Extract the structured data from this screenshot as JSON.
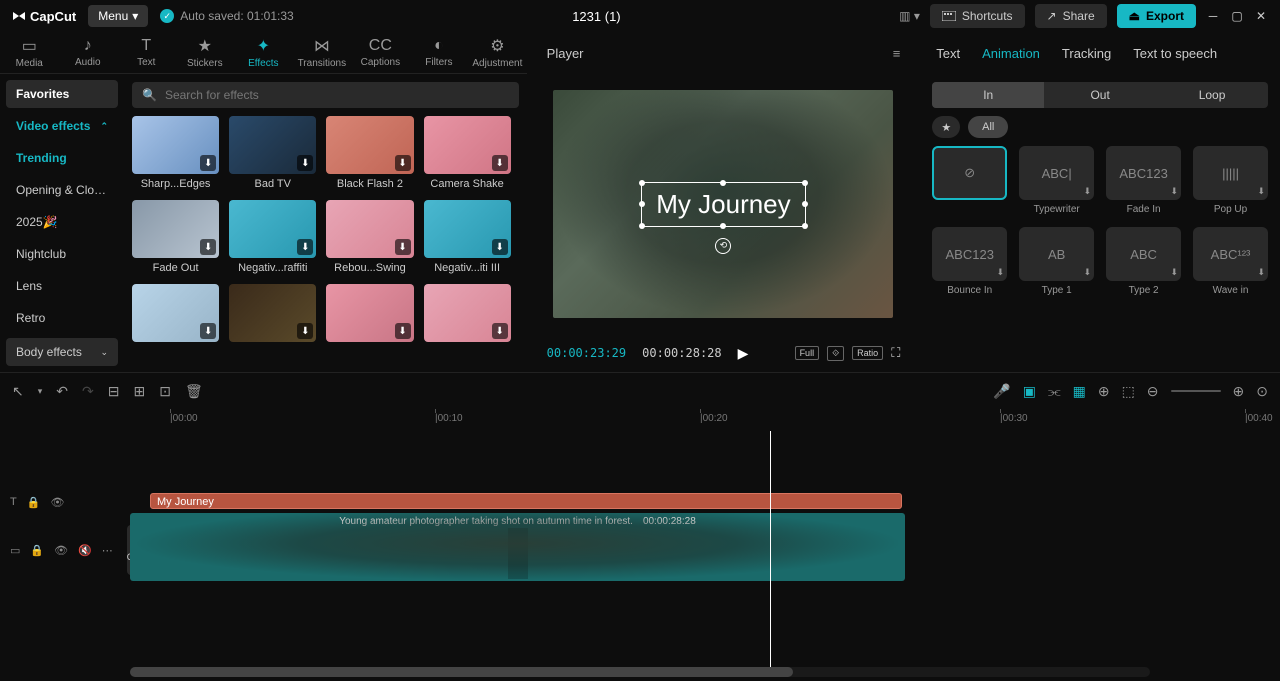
{
  "titlebar": {
    "app": "CapCut",
    "menu": "Menu",
    "autosaved": "Auto saved: 01:01:33",
    "project": "1231 (1)",
    "shortcuts": "Shortcuts",
    "share": "Share",
    "export": "Export"
  },
  "tabs": [
    "Media",
    "Audio",
    "Text",
    "Stickers",
    "Effects",
    "Transitions",
    "Captions",
    "Filters",
    "Adjustment"
  ],
  "activeTab": 4,
  "sidebar": {
    "items": [
      "Favorites",
      "Video effects",
      "Trending",
      "Opening & Clos...",
      "2025🎉",
      "Nightclub",
      "Lens",
      "Retro"
    ],
    "bottom": "Body effects"
  },
  "search": {
    "placeholder": "Search for effects"
  },
  "effects": [
    {
      "label": "Sharp...Edges",
      "bg": "linear-gradient(135deg,#a8c4e8,#6890c0)"
    },
    {
      "label": "Bad TV",
      "bg": "linear-gradient(135deg,#2a4a6a,#1a2a3a)"
    },
    {
      "label": "Black Flash 2",
      "bg": "linear-gradient(135deg,#d88575,#c06555)"
    },
    {
      "label": "Camera Shake",
      "bg": "linear-gradient(135deg,#e895a5,#d07585)"
    },
    {
      "label": "Fade Out",
      "bg": "linear-gradient(135deg,#8898a8,#b8c4d0)"
    },
    {
      "label": "Negativ...raffiti",
      "bg": "linear-gradient(135deg,#4ab8d0,#2898b0)"
    },
    {
      "label": "Rebou...Swing",
      "bg": "linear-gradient(135deg,#e8a5b5,#d88595)"
    },
    {
      "label": "Negativ...iti III",
      "bg": "linear-gradient(135deg,#4ab8d0,#2898b0)"
    },
    {
      "label": "",
      "bg": "linear-gradient(135deg,#b8d4e8,#98b4c8)"
    },
    {
      "label": "",
      "bg": "linear-gradient(135deg,#3a2a1a,#5a4a2a)"
    },
    {
      "label": "",
      "bg": "linear-gradient(135deg,#e895a5,#c87585)"
    },
    {
      "label": "",
      "bg": "linear-gradient(135deg,#e8a5b5,#d88595)"
    }
  ],
  "player": {
    "label": "Player",
    "text": "My Journey",
    "tc1": "00:00:23:29",
    "tc2": "00:00:28:28",
    "full": "Full",
    "ratio": "Ratio"
  },
  "inspector": {
    "tabs": [
      "Text",
      "Animation",
      "Tracking",
      "Text to speech"
    ],
    "activeTab": 1,
    "seg": [
      "In",
      "Out",
      "Loop"
    ],
    "activeSeg": 0,
    "all": "All",
    "items": [
      {
        "label": "",
        "sel": true,
        "t": "⊘"
      },
      {
        "label": "Typewriter",
        "t": "ABC|"
      },
      {
        "label": "Fade In",
        "t": "ABC123"
      },
      {
        "label": "Pop Up",
        "t": "|||||"
      },
      {
        "label": "Bounce In",
        "t": "ABC123"
      },
      {
        "label": "Type 1",
        "t": "AB"
      },
      {
        "label": "Type 2",
        "t": "ABC"
      },
      {
        "label": "Wave in",
        "t": "ABC¹²³"
      }
    ]
  },
  "ruler": [
    "|00:00",
    "|00:10",
    "|00:20",
    "|00:30",
    "|00:40"
  ],
  "timeline": {
    "textclip": "My Journey",
    "videoclip": "Young amateur photographer taking shot on autumn time in forest.",
    "videodur": "00:00:28:28",
    "cover": "Cover"
  }
}
